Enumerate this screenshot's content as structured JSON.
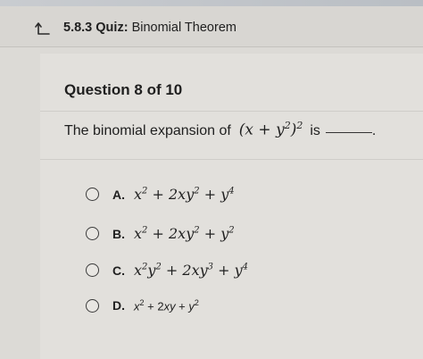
{
  "header": {
    "section_number": "5.8.3",
    "quiz_label": "Quiz:",
    "quiz_topic": "Binomial Theorem",
    "back_icon": "back-arrow-icon"
  },
  "question": {
    "counter": "Question 8 of 10",
    "prompt_before": "The binomial expansion of",
    "prompt_after": "is",
    "period": "."
  },
  "options": [
    {
      "letter": "A."
    },
    {
      "letter": "B."
    },
    {
      "letter": "C."
    },
    {
      "letter": "D."
    }
  ]
}
